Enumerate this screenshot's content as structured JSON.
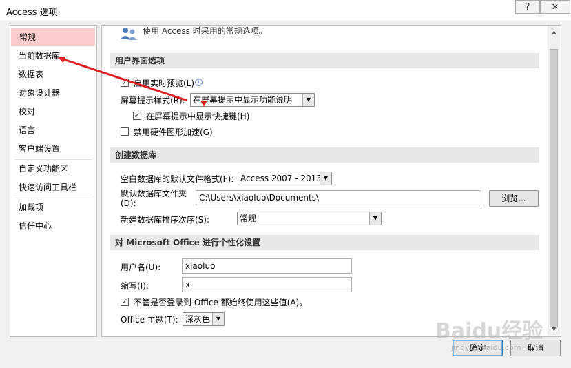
{
  "window": {
    "title": "Access 选项",
    "help_label": "?",
    "close_label": "✕"
  },
  "sidebar": {
    "items": [
      {
        "label": "常规"
      },
      {
        "label": "当前数据库"
      },
      {
        "label": "数据表"
      },
      {
        "label": "对象设计器"
      },
      {
        "label": "校对"
      },
      {
        "label": "语言"
      },
      {
        "label": "客户端设置"
      },
      {
        "label": "自定义功能区"
      },
      {
        "label": "快速访问工具栏"
      },
      {
        "label": "加载项"
      },
      {
        "label": "信任中心"
      }
    ]
  },
  "content": {
    "intro_text": "使用 Access 时采用的常规选项。",
    "ui_section": {
      "header": "用户界面选项",
      "realtime_preview_label": "启用实时预览(L)",
      "realtime_preview_checked": "✓",
      "screentip_style_label": "屏幕提示样式(R):",
      "screentip_style_value": "在屏幕提示中显示功能说明",
      "show_shortcut_label": "在屏幕提示中显示快捷键(H)",
      "show_shortcut_checked": "✓",
      "disable_hw_accel_label": "禁用硬件图形加速(G)",
      "disable_hw_accel_checked": ""
    },
    "db_section": {
      "header": "创建数据库",
      "default_format_label": "空白数据库的默认文件格式(F):",
      "default_format_value": "Access 2007 - 2013",
      "default_folder_label_1": "默认数据库文件夹",
      "default_folder_label_2": "(D):",
      "default_folder_value": "C:\\Users\\xiaoluo\\Documents\\",
      "browse_label": "浏览...",
      "sort_order_label": "新建数据库排序次序(S):",
      "sort_order_value": "常规"
    },
    "personalize_section": {
      "header": "对 Microsoft Office 进行个性化设置",
      "username_label": "用户名(U):",
      "username_value": "xiaoluo",
      "initials_label": "缩写(I):",
      "initials_value": "x",
      "always_use_label": "不管是否登录到 Office 都始终使用这些值(A)。",
      "always_use_checked": "✓",
      "theme_label": "Office 主题(T):",
      "theme_value": "深灰色"
    }
  },
  "footer": {
    "ok_label": "确定",
    "cancel_label": "取消"
  },
  "watermark": {
    "text": "Baidu经验",
    "url": "jingyan.baidu.com"
  },
  "annotation_color": "#e02020"
}
